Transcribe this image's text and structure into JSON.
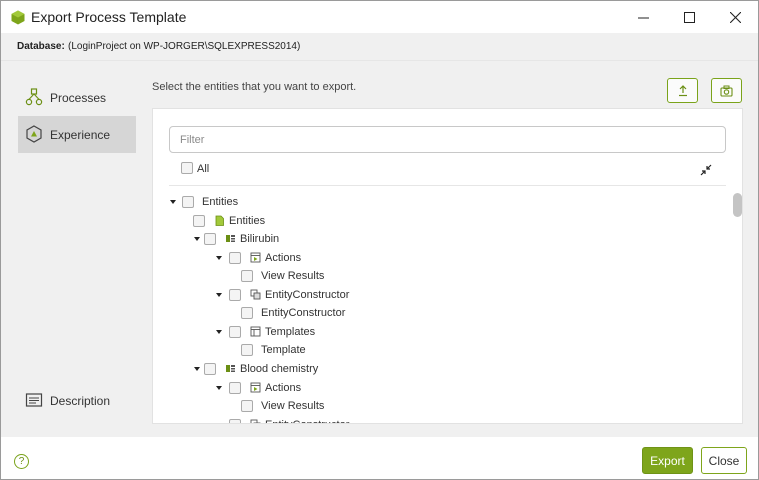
{
  "window": {
    "title": "Export Process Template",
    "accent_color": "#7ea51b",
    "icons": {
      "app": "green-hexagon-icon",
      "minimize": "minimize-icon",
      "maximize": "maximize-icon",
      "close": "close-icon"
    }
  },
  "database": {
    "label": "Database:",
    "value": "(LoginProject on WP-JORGER\\SQLEXPRESS2014)"
  },
  "sidebar": {
    "items": [
      {
        "label": "Processes",
        "icon": "processes-icon",
        "active": false
      },
      {
        "label": "Experience",
        "icon": "experience-icon",
        "active": true
      },
      {
        "label": "Description",
        "icon": "description-icon",
        "active": false
      }
    ]
  },
  "main": {
    "instructions": "Select the entities that you want to export.",
    "toolbar": {
      "import_icon": "upload-icon",
      "camera_icon": "camera-icon"
    },
    "filter_placeholder": "Filter",
    "all_label": "All",
    "collapse_icon": "collapse-arrows-icon",
    "tree": [
      {
        "label": "Entities",
        "level": 0,
        "expanded": true,
        "icon": ""
      },
      {
        "label": "Entities",
        "level": 1,
        "expanded": null,
        "icon": "entity-file-icon"
      },
      {
        "label": "Bilirubin",
        "level": 1,
        "expanded": true,
        "icon": "entity-icon"
      },
      {
        "label": "Actions",
        "level": 2,
        "expanded": true,
        "icon": "actions-icon"
      },
      {
        "label": "View Results",
        "level": 3,
        "expanded": null,
        "icon": ""
      },
      {
        "label": "EntityConstructor",
        "level": 2,
        "expanded": true,
        "icon": "constructor-icon"
      },
      {
        "label": "EntityConstructor",
        "level": 3,
        "expanded": null,
        "icon": ""
      },
      {
        "label": "Templates",
        "level": 2,
        "expanded": true,
        "icon": "templates-icon"
      },
      {
        "label": "Template",
        "level": 3,
        "expanded": null,
        "icon": ""
      },
      {
        "label": "Blood chemistry",
        "level": 1,
        "expanded": true,
        "icon": "entity-icon"
      },
      {
        "label": "Actions",
        "level": 2,
        "expanded": true,
        "icon": "actions-icon"
      },
      {
        "label": "View Results",
        "level": 3,
        "expanded": null,
        "icon": ""
      },
      {
        "label": "EntityConstructor",
        "level": 2,
        "expanded": true,
        "icon": "constructor-icon"
      }
    ]
  },
  "footer": {
    "help_icon": "help-icon",
    "help_glyph": "?",
    "export_label": "Export",
    "close_label": "Close"
  }
}
